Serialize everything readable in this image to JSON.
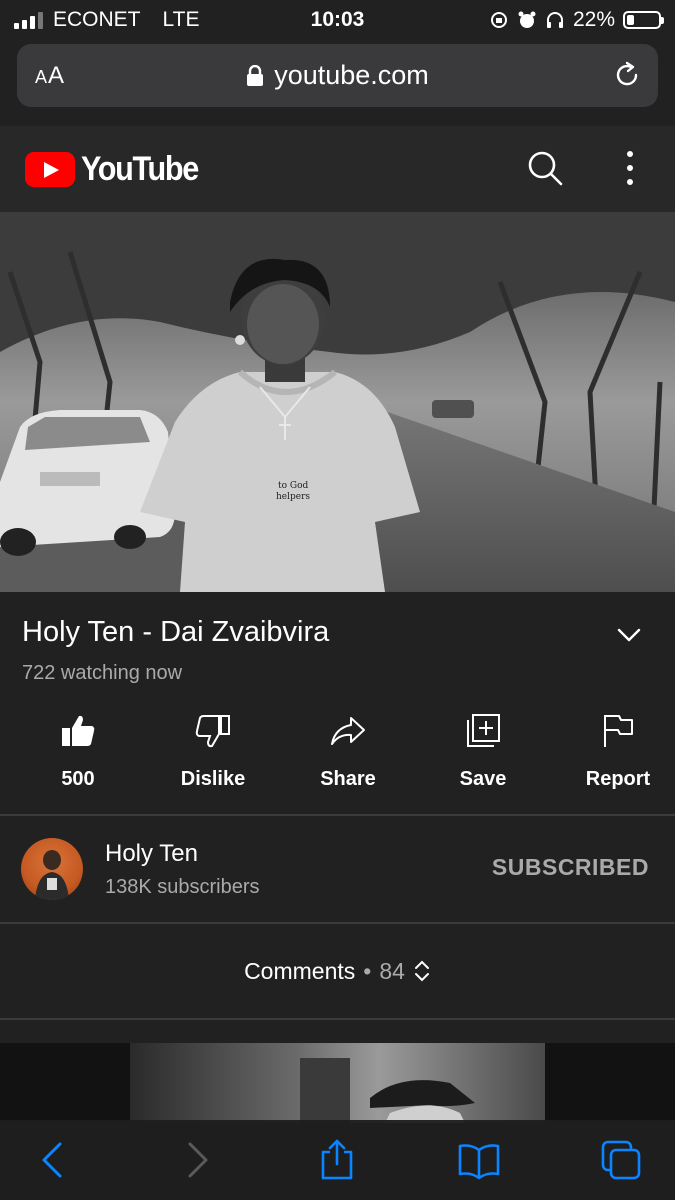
{
  "status_bar": {
    "carrier": "ECONET",
    "network": "LTE",
    "time": "10:03",
    "battery_percent": "22%",
    "battery_level": 0.22
  },
  "browser": {
    "aa_label_small": "A",
    "aa_label_large": "A",
    "url": "youtube.com"
  },
  "youtube": {
    "logo_text": "YouTube"
  },
  "video": {
    "title": "Holy Ten - Dai Zvaibvira",
    "watching": "722 watching now",
    "shirt_text_1": "to God",
    "shirt_text_2": "helpers"
  },
  "actions": {
    "like_label": "500",
    "dislike_label": "Dislike",
    "share_label": "Share",
    "save_label": "Save",
    "report_label": "Report"
  },
  "channel": {
    "name": "Holy Ten",
    "subscribers": "138K subscribers",
    "subscribe_state": "SUBSCRIBED"
  },
  "comments": {
    "label": "Comments",
    "separator": "•",
    "count": "84"
  },
  "colors": {
    "background": "#212121",
    "header": "#282828",
    "brand_red": "#ff0000",
    "safari_blue": "#0a84ff",
    "secondary_text": "#aaaaaa"
  }
}
